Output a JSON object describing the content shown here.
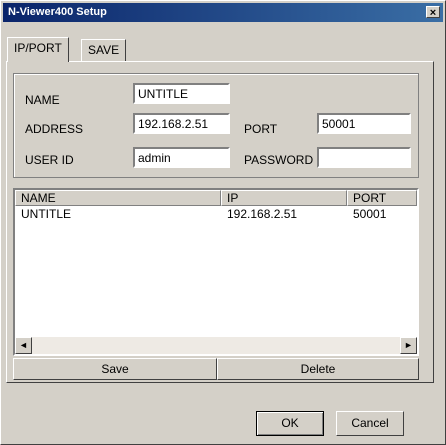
{
  "window": {
    "title": "N-Viewer400 Setup",
    "close_glyph": "×"
  },
  "tabs": [
    {
      "label": "IP/PORT",
      "active": true
    },
    {
      "label": "SAVE",
      "active": false
    }
  ],
  "form": {
    "name_label": "NAME",
    "name_value": "UNTITLE",
    "address_label": "ADDRESS",
    "address_value": "192.168.2.51",
    "port_label": "PORT",
    "port_value": "50001",
    "userid_label": "USER ID",
    "userid_value": "admin",
    "password_label": "PASSWORD",
    "password_value": ""
  },
  "list": {
    "columns": [
      "NAME",
      "IP",
      "PORT"
    ],
    "rows": [
      {
        "name": "UNTITLE",
        "ip": "192.168.2.51",
        "port": "50001"
      }
    ],
    "scroll_left_icon": "◄",
    "scroll_right_icon": "►"
  },
  "actions": {
    "save_label": "Save",
    "delete_label": "Delete"
  },
  "footer": {
    "ok_label": "OK",
    "cancel_label": "Cancel"
  }
}
